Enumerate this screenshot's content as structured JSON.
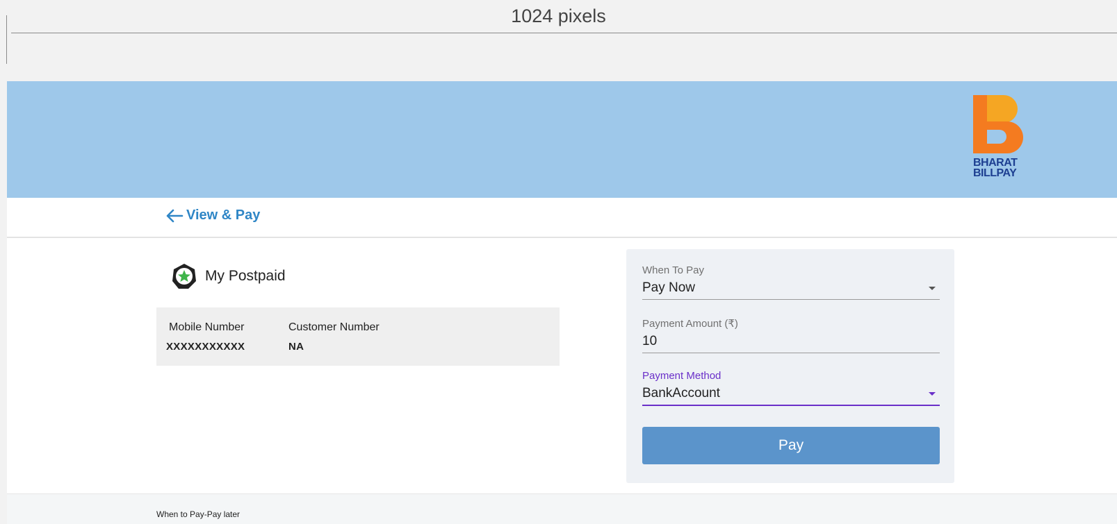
{
  "annotation": {
    "label": "1024 pixels"
  },
  "header": {
    "logo": {
      "line1": "BHARAT",
      "line2": "BILLPAY",
      "colors": {
        "orange": "#f47b20",
        "yellow": "#f5a623",
        "blue": "#1d3f91"
      }
    },
    "background": "#9ec8ea"
  },
  "nav": {
    "back_icon": "arrow-left-icon",
    "title": "View & Pay"
  },
  "biller": {
    "icon": "hexagon-star-icon",
    "name": "My Postpaid"
  },
  "account": {
    "mobile_label": "Mobile Number",
    "mobile_value": "XXXXXXXXXXX",
    "customer_label": "Customer Number",
    "customer_value": "NA"
  },
  "form": {
    "when_to_pay": {
      "label": "When To Pay",
      "value": "Pay Now"
    },
    "amount": {
      "label": "Payment Amount (₹)",
      "value": "10"
    },
    "method": {
      "label": "Payment Method",
      "value": "BankAccount"
    },
    "pay_button": "Pay",
    "accent": "#6a2fc9",
    "button_color": "#5b94cb"
  },
  "footer": {
    "text": "When to Pay-Pay later"
  }
}
